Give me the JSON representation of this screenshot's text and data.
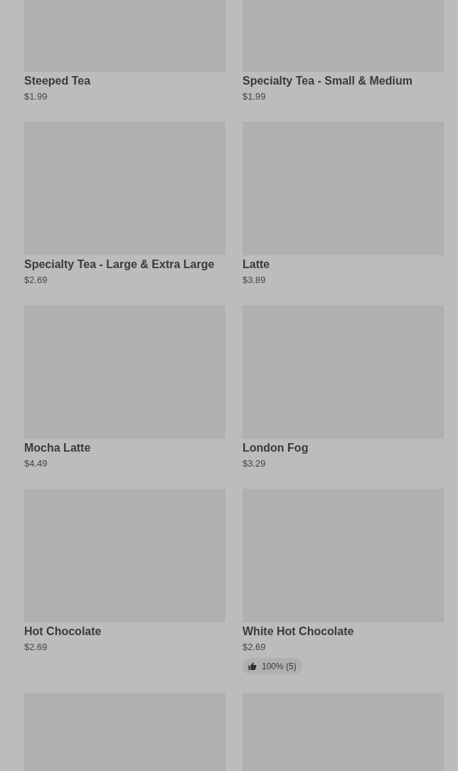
{
  "products": [
    {
      "kind": "product",
      "name": "Steeped Tea",
      "price": "$1.99"
    },
    {
      "kind": "product",
      "name": "Specialty Tea - Small & Medium",
      "price": "$1.99"
    },
    {
      "kind": "product",
      "name": "Specialty Tea - Large & Extra Large",
      "price": "$2.69"
    },
    {
      "kind": "product",
      "name": "Latte",
      "price": "$3.89"
    },
    {
      "kind": "product",
      "name": "Mocha Latte",
      "price": "$4.49"
    },
    {
      "kind": "product",
      "name": "London Fog",
      "price": "$3.29"
    },
    {
      "kind": "product",
      "name": "Hot Chocolate",
      "price": "$2.69"
    },
    {
      "kind": "product",
      "name": "White Hot Chocolate",
      "price": "$2.69",
      "rating": "100% (5)"
    },
    {
      "kind": "image_only"
    },
    {
      "kind": "image_only"
    }
  ]
}
